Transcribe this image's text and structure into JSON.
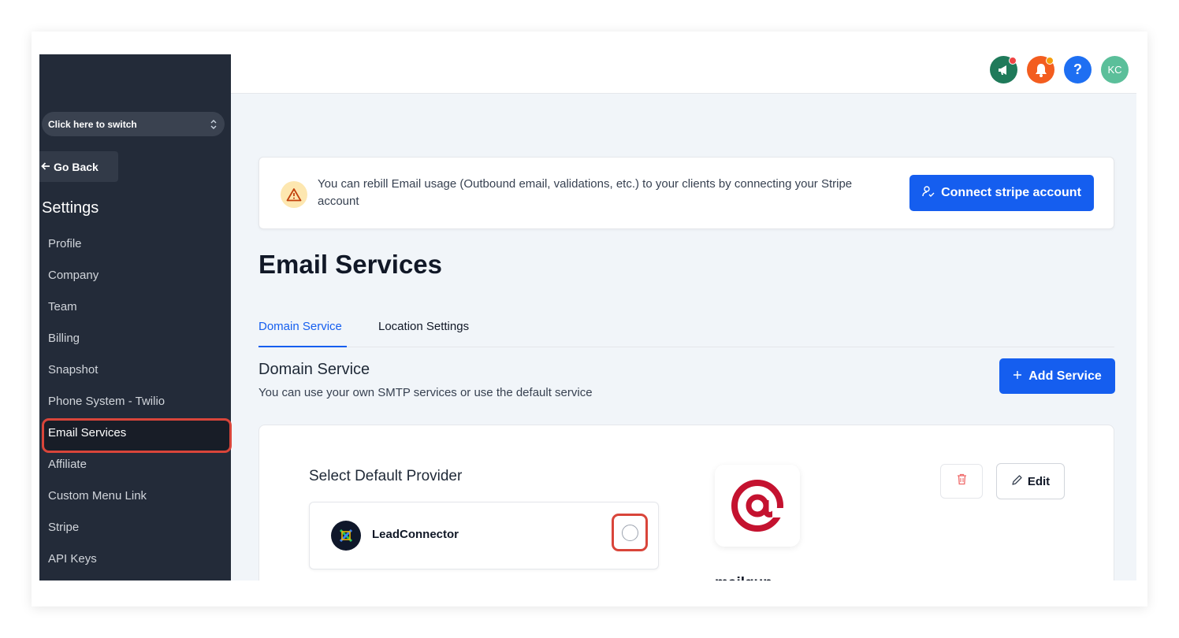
{
  "sidebar": {
    "switcher_label": "Click here to switch",
    "go_back_label": "Go Back",
    "settings_title": "Settings",
    "items": [
      {
        "label": "Profile"
      },
      {
        "label": "Company"
      },
      {
        "label": "Team"
      },
      {
        "label": "Billing"
      },
      {
        "label": "Snapshot"
      },
      {
        "label": "Phone System - Twilio"
      },
      {
        "label": "Email Services"
      },
      {
        "label": "Affiliate"
      },
      {
        "label": "Custom Menu Link"
      },
      {
        "label": "Stripe"
      },
      {
        "label": "API Keys"
      }
    ],
    "active_item": "Email Services",
    "highlight_color": "#d9453a"
  },
  "header": {
    "icons": [
      {
        "name": "megaphone-icon",
        "bg": "#1f7a5a",
        "has_dot": true,
        "dot_color": "#ef4444"
      },
      {
        "name": "bell-icon",
        "bg": "#f35d1f",
        "has_dot": true,
        "dot_color": "#f59e0b"
      },
      {
        "name": "help-icon",
        "bg": "#1e6ff2",
        "glyph": "?"
      },
      {
        "name": "avatar",
        "bg": "#5bbf9a",
        "initials": "KC"
      }
    ]
  },
  "banner": {
    "text": "You can rebill Email usage (Outbound email, validations, etc.) to your clients by connecting your Stripe account",
    "button_label": "Connect stripe account"
  },
  "page": {
    "title": "Email Services"
  },
  "tabs": [
    {
      "label": "Domain Service",
      "active": true
    },
    {
      "label": "Location Settings",
      "active": false
    }
  ],
  "section": {
    "title": "Domain Service",
    "subtitle": "You can use your own SMTP services or use the default service",
    "add_button_label": "Add Service"
  },
  "provider_card": {
    "select_title": "Select Default Provider",
    "provider_name": "LeadConnector",
    "mailgun_name": "mailgun",
    "edit_label": "Edit"
  },
  "colors": {
    "primary": "#155eef",
    "sidebar_bg": "#232b39",
    "main_bg": "#f1f5f9",
    "mailgun_red": "#c4122f"
  }
}
